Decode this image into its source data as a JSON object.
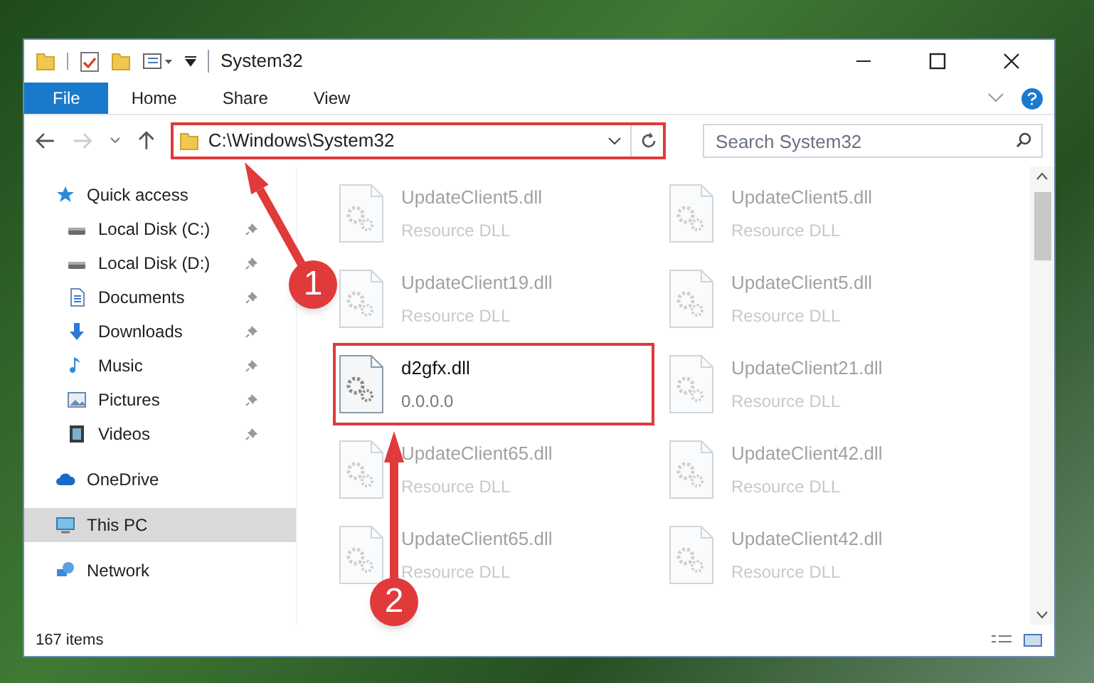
{
  "window": {
    "title": "System32"
  },
  "ribbon_tabs": [
    {
      "label": "File",
      "selected": true
    },
    {
      "label": "Home",
      "selected": false
    },
    {
      "label": "Share",
      "selected": false
    },
    {
      "label": "View",
      "selected": false
    }
  ],
  "address_bar": {
    "path": "C:\\Windows\\System32",
    "highlighted": true
  },
  "search": {
    "placeholder": "Search System32"
  },
  "sidebar": {
    "items": [
      {
        "label": "Quick access",
        "selected": false,
        "children": [
          {
            "label": "Local Disk (C:)",
            "pinned": true,
            "selected": false
          },
          {
            "label": "Local Disk (D:)",
            "pinned": true,
            "selected": false
          },
          {
            "label": "Documents",
            "pinned": true,
            "selected": false
          },
          {
            "label": "Downloads",
            "pinned": true,
            "selected": false
          },
          {
            "label": "Music",
            "pinned": true,
            "selected": false
          },
          {
            "label": "Pictures",
            "pinned": true,
            "selected": false
          },
          {
            "label": "Videos",
            "pinned": true,
            "selected": false
          }
        ]
      },
      {
        "label": "OneDrive",
        "selected": false
      },
      {
        "label": "This PC",
        "selected": true
      },
      {
        "label": "Network",
        "selected": false
      }
    ]
  },
  "files": [
    {
      "name": "UpdateClient5.dll",
      "detail": "Resource DLL",
      "faded": true,
      "highlighted": false
    },
    {
      "name": "UpdateClient5.dll",
      "detail": "Resource DLL",
      "faded": true,
      "highlighted": false
    },
    {
      "name": "UpdateClient19.dll",
      "detail": "Resource DLL",
      "faded": true,
      "highlighted": false
    },
    {
      "name": "UpdateClient5.dll",
      "detail": "Resource DLL",
      "faded": true,
      "highlighted": false
    },
    {
      "name": "d2gfx.dll",
      "detail": "0.0.0.0",
      "faded": false,
      "highlighted": true
    },
    {
      "name": "UpdateClient21.dll",
      "detail": "Resource DLL",
      "faded": true,
      "highlighted": false
    },
    {
      "name": "UpdateClient65.dll",
      "detail": "Resource DLL",
      "faded": true,
      "highlighted": false
    },
    {
      "name": "UpdateClient42.dll",
      "detail": "Resource DLL",
      "faded": true,
      "highlighted": false
    },
    {
      "name": "UpdateClient65.dll",
      "detail": "Resource DLL",
      "faded": true,
      "highlighted": false
    },
    {
      "name": "UpdateClient42.dll",
      "detail": "Resource DLL",
      "faded": true,
      "highlighted": false
    }
  ],
  "status_bar": {
    "item_count": "167 items"
  },
  "annotations": [
    {
      "number": "1"
    },
    {
      "number": "2"
    }
  ]
}
